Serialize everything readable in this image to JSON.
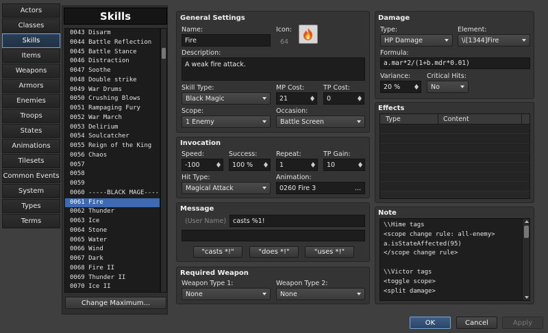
{
  "nav": {
    "items": [
      "Actors",
      "Classes",
      "Skills",
      "Items",
      "Weapons",
      "Armors",
      "Enemies",
      "Troops",
      "States",
      "Animations",
      "Tilesets",
      "Common Events",
      "System",
      "Types",
      "Terms"
    ],
    "active_index": 2
  },
  "list": {
    "title": "Skills",
    "items": [
      "0043 Disarm",
      "0044 Battle Reflection",
      "0045 Battle Stance",
      "0046 Distraction",
      "0047 Soothe",
      "0048 Double strike",
      "0049 War Drums",
      "0050 Crushing Blows",
      "0051 Rampaging Fury",
      "0052 War March",
      "0053 Delirium",
      "0054 Soulcatcher",
      "0055 Reign of the King",
      "0056 Chaos",
      "0057",
      "0058",
      "0059",
      "0060 -----BLACK MAGE-------",
      "0061 Fire",
      "0062 Thunder",
      "0063 Ice",
      "0064 Stone",
      "0065 Water",
      "0066 Wind",
      "0067 Dark",
      "0068 Fire II",
      "0069 Thunder II",
      "0070 Ice II"
    ],
    "selected_index": 18,
    "change_max_label": "Change Maximum..."
  },
  "general": {
    "title": "General Settings",
    "name_label": "Name:",
    "name_value": "Fire",
    "icon_label": "Icon:",
    "icon_index": "64",
    "desc_label": "Description:",
    "desc_value": "A weak fire attack.",
    "skill_type_label": "Skill Type:",
    "skill_type_value": "Black Magic",
    "mp_label": "MP Cost:",
    "mp_value": "21",
    "tp_label": "TP Cost:",
    "tp_value": "0",
    "scope_label": "Scope:",
    "scope_value": "1 Enemy",
    "occasion_label": "Occasion:",
    "occasion_value": "Battle Screen"
  },
  "invocation": {
    "title": "Invocation",
    "speed_label": "Speed:",
    "speed_value": "-100",
    "success_label": "Success:",
    "success_value": "100 %",
    "repeat_label": "Repeat:",
    "repeat_value": "1",
    "tpgain_label": "TP Gain:",
    "tpgain_value": "10",
    "hit_label": "Hit Type:",
    "hit_value": "Magical Attack",
    "anim_label": "Animation:",
    "anim_value": "0260 Fire 3",
    "anim_more": "..."
  },
  "message": {
    "title": "Message",
    "user_name_hint": "(User Name)",
    "line1": "casts %1!",
    "line2": "",
    "btn1": "\"casts *!\"",
    "btn2": "\"does *!\"",
    "btn3": "\"uses *!\""
  },
  "weapon": {
    "title": "Required Weapon",
    "wt1_label": "Weapon Type 1:",
    "wt1_value": "None",
    "wt2_label": "Weapon Type 2:",
    "wt2_value": "None"
  },
  "damage": {
    "title": "Damage",
    "type_label": "Type:",
    "type_value": "HP Damage",
    "element_label": "Element:",
    "element_value": "\\i[1344]Fire",
    "formula_label": "Formula:",
    "formula_value": "a.mar*2/(1+b.mdr*0.01)",
    "variance_label": "Variance:",
    "variance_value": "20 %",
    "critical_label": "Critical Hits:",
    "critical_value": "No"
  },
  "effects": {
    "title": "Effects",
    "col_type": "Type",
    "col_content": "Content"
  },
  "note": {
    "title": "Note",
    "lines": [
      "\\\\Hime tags",
      "<scope change rule: all-enemy>",
      "a.isStateAffected(95)",
      "</scope change rule>",
      "",
      "\\\\Victor tags",
      "<toggle scope>",
      "<split damage>"
    ]
  },
  "footer": {
    "ok": "OK",
    "cancel": "Cancel",
    "apply": "Apply"
  },
  "colors": {
    "accent": "#3d6ab0",
    "active_nav_border": "#6a9fd0"
  }
}
